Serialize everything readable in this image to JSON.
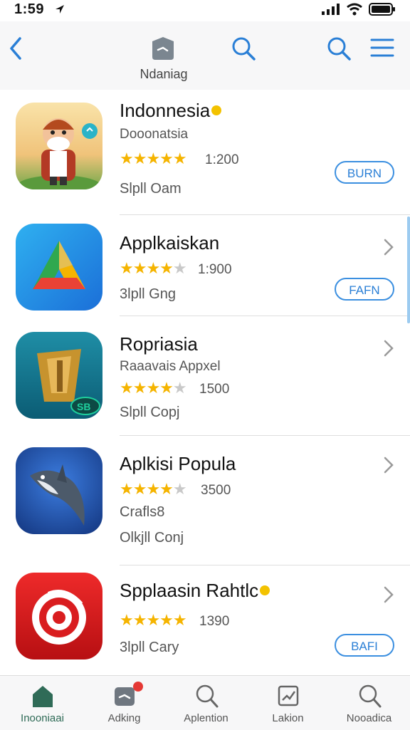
{
  "status_bar": {
    "time": "1:59"
  },
  "nav": {
    "title": "Ndaniag"
  },
  "apps": [
    {
      "name": "Indonnesia",
      "subtitle": "Dooonatsia",
      "rating_count": "1:200",
      "stars": 5,
      "meta": "Slpll Oam",
      "button": "BURN",
      "has_button": true,
      "has_badge": true
    },
    {
      "name": "Applkaiskan",
      "subtitle": "",
      "rating_count": "1:900",
      "stars": 4.5,
      "meta": "3lpll Gng",
      "button": "FAFN",
      "has_button": true,
      "has_badge": false
    },
    {
      "name": "Ropriasia",
      "subtitle": "Raaavais Appxel",
      "rating_count": "1500",
      "stars": 4.5,
      "meta": "Slpll Copj",
      "button": "",
      "has_button": false,
      "has_badge": false
    },
    {
      "name": "Aplkisi Popula",
      "subtitle": "",
      "rating_count": "3500",
      "stars": 4.5,
      "meta": "Crafls8",
      "meta2": "Olkjll Conj",
      "button": "",
      "has_button": false,
      "has_badge": false
    },
    {
      "name": "Spplaasin Rahtlc",
      "subtitle": "",
      "rating_count": "1390",
      "stars": 5,
      "meta": "3lpll Cary",
      "button": "BAFI",
      "has_button": true,
      "has_badge": true
    }
  ],
  "icons": {
    "app1": "cartoon-character-icon",
    "app2": "triangle-logo-icon",
    "app3": "shield-logo-icon",
    "app4": "shark-icon",
    "app5": "red-target-icon"
  },
  "tabs": [
    {
      "label": "Inooniaai",
      "icon": "home-icon",
      "active": true
    },
    {
      "label": "Adking",
      "icon": "tag-icon",
      "active": false,
      "notification": true
    },
    {
      "label": "Aplention",
      "icon": "search-icon",
      "active": false
    },
    {
      "label": "Lakion",
      "icon": "chart-icon",
      "active": false
    },
    {
      "label": "Nooadica",
      "icon": "search-icon",
      "active": false
    }
  ],
  "colors": {
    "accent": "#2a7fd6",
    "star": "#f5b400",
    "active_tab": "#2f6b57",
    "notification": "#e53935"
  }
}
